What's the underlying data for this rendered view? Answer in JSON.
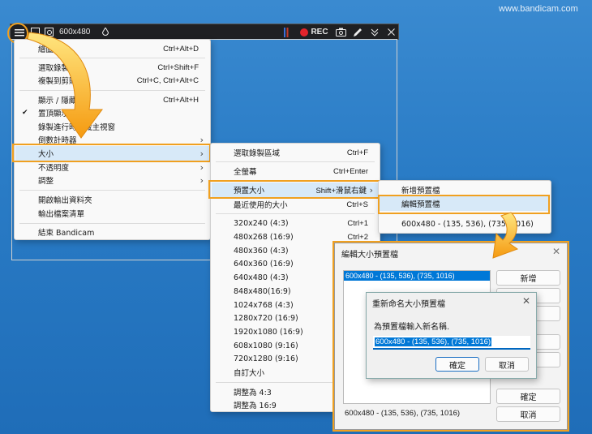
{
  "watermark": "www.bandicam.com",
  "toolbar": {
    "size_label": "600x480",
    "rec_label": "REC",
    "icons": [
      "menu-icon",
      "window-icon",
      "search-window-icon",
      "droplet-icon",
      "camera-icon",
      "pencil-icon",
      "collapse-icon",
      "close-icon"
    ]
  },
  "main_menu": {
    "items": [
      {
        "label": "繪圖工具",
        "shortcut": "Ctrl+Alt+D"
      },
      {
        "label": "選取錄製區",
        "shortcut": "Ctrl+Shift+F"
      },
      {
        "label": "複製到剪貼板",
        "shortcut": "Ctrl+C, Ctrl+Alt+C"
      },
      {
        "label": "顯示 / 隱藏",
        "shortcut": "Ctrl+Alt+H"
      },
      {
        "label": "置頂顯示",
        "checked": true
      },
      {
        "label": "錄製進行時隱藏主視窗"
      },
      {
        "label": "倒數計時器",
        "submenu": true
      },
      {
        "label": "大小",
        "submenu": true,
        "highlighted": true
      },
      {
        "label": "不透明度",
        "submenu": true
      },
      {
        "label": "調整",
        "submenu": true
      },
      {
        "label": "開啟輸出資料夾"
      },
      {
        "label": "輸出檔案清單"
      },
      {
        "label": "結束 Bandicam"
      }
    ]
  },
  "size_menu": {
    "items": [
      {
        "label": "選取錄製區域",
        "shortcut": "Ctrl+F"
      },
      {
        "label": "全螢幕",
        "shortcut": "Ctrl+Enter"
      },
      {
        "label": "預置大小",
        "shortcut": "Shift+滑鼠右鍵",
        "submenu": true,
        "highlighted": true
      },
      {
        "label": "最近使用的大小",
        "shortcut": "Ctrl+S"
      },
      {
        "label": "320x240 (4:3)",
        "shortcut": "Ctrl+1"
      },
      {
        "label": "480x268 (16:9)",
        "shortcut": "Ctrl+2"
      },
      {
        "label": "480x360 (4:3)"
      },
      {
        "label": "640x360 (16:9)"
      },
      {
        "label": "640x480 (4:3)"
      },
      {
        "label": "848x480(16:9)"
      },
      {
        "label": "1024x768 (4:3)"
      },
      {
        "label": "1280x720 (16:9)"
      },
      {
        "label": "1920x1080 (16:9)"
      },
      {
        "label": "608x1080 (9:16)"
      },
      {
        "label": "720x1280 (9:16)"
      },
      {
        "label": "自訂大小"
      },
      {
        "label": "調整為 4:3"
      },
      {
        "label": "調整為 16:9"
      }
    ]
  },
  "preset_menu": {
    "items": [
      {
        "label": "新增預置檔"
      },
      {
        "label": "編輯預置檔",
        "highlighted": true
      },
      {
        "label": "600x480 - (135, 536), (735, 1016)"
      }
    ]
  },
  "edit_dialog": {
    "title": "編輯大小預置檔",
    "list_items": [
      "600x480 - (135, 536), (735, 1016)"
    ],
    "footer_text": "600x480 - (135, 536), (735, 1016)",
    "buttons": {
      "add": "新增",
      "delete": "刪除",
      "rename": "更名",
      "ok": "確定",
      "cancel": "取消"
    }
  },
  "rename_dialog": {
    "title": "重新命名大小預置檔",
    "prompt": "為預置檔輸入新名稱.",
    "input_value": "600x480 - (135, 536), (735, 1016)",
    "ok": "確定",
    "cancel": "取消"
  },
  "colors": {
    "highlight_border": "#f0a020",
    "selection": "#0078d7",
    "rec": "#e3242b"
  }
}
